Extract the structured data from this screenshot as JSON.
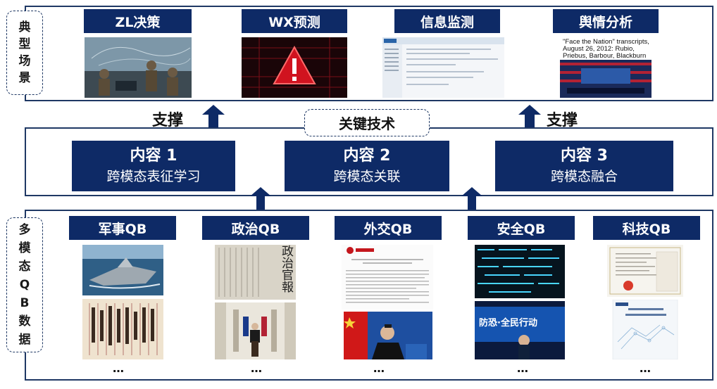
{
  "top": {
    "side_label": [
      "典",
      "型",
      "场",
      "景"
    ],
    "scenarios": [
      {
        "title": "ZL决策"
      },
      {
        "title": "WX预测"
      },
      {
        "title": "信息监测"
      },
      {
        "title": "舆情分析",
        "caption_lines": [
          "\"Face the Nation\" transcripts,",
          "August 26, 2012: Rubio,",
          "Priebus, Barbour, Blackburn"
        ]
      }
    ]
  },
  "middle": {
    "support_left": "支撑",
    "support_right": "支撑",
    "key_tech": "关键技术",
    "contents": [
      {
        "title": "内容 1",
        "subtitle": "跨模态表征学习"
      },
      {
        "title": "内容 2",
        "subtitle": "跨模态关联"
      },
      {
        "title": "内容 3",
        "subtitle": "跨模态融合"
      }
    ]
  },
  "bottom": {
    "side_label": [
      "多",
      "模",
      "态",
      "Q",
      "B",
      "数",
      "据"
    ],
    "categories": [
      {
        "title": "军事QB",
        "ellipsis": "…"
      },
      {
        "title": "政治QB",
        "ellipsis": "…"
      },
      {
        "title": "外交QB",
        "ellipsis": "…"
      },
      {
        "title": "安全QB",
        "ellipsis": "…"
      },
      {
        "title": "科技QB",
        "ellipsis": "…"
      }
    ],
    "newspaper_text": "政治官報",
    "security_banner": "防恐·全民行动"
  },
  "colors": {
    "navy": "#0e2a66",
    "border": "#1f3864"
  }
}
